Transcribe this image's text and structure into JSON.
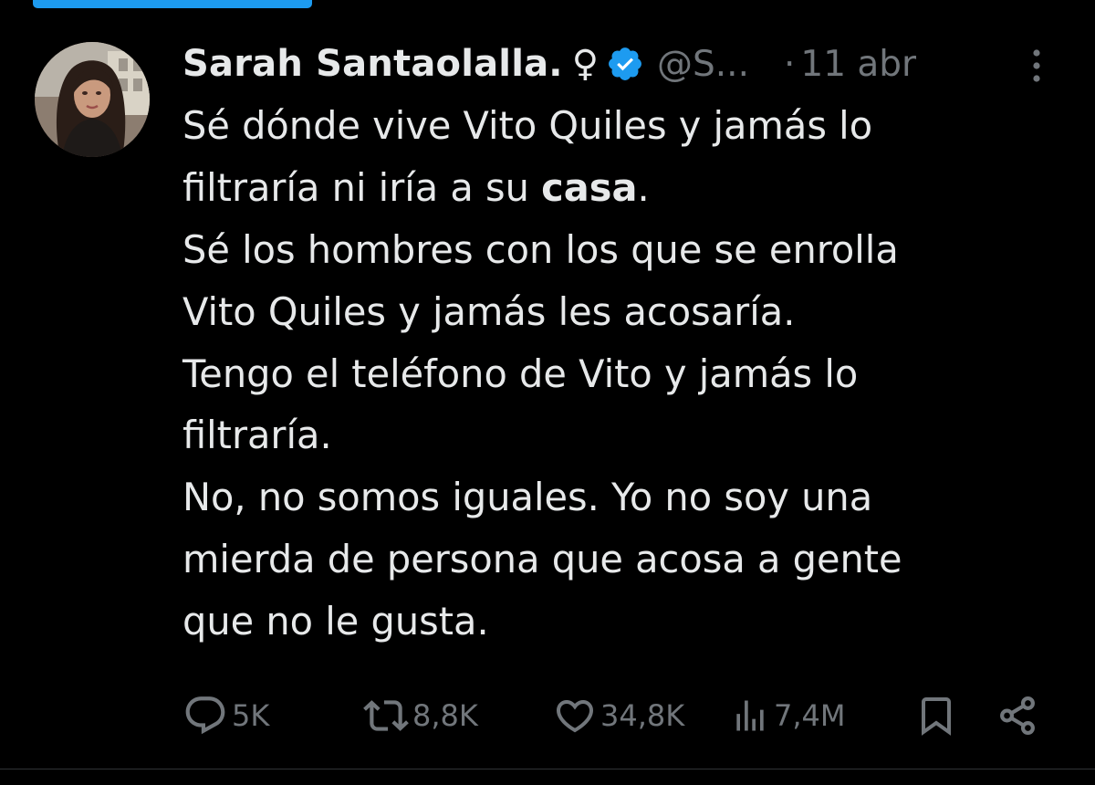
{
  "colors": {
    "background": "#000000",
    "text_primary": "#e7e9ea",
    "text_secondary": "#71767b",
    "accent": "#1d9bf0"
  },
  "author": {
    "avatar_icon": "profile-photo",
    "display_name": "Sarah Santaolalla.",
    "name_symbol": "♀",
    "verified_icon": "verified-badge-icon",
    "handle": "@S...",
    "separator": "·",
    "date": "11 abr",
    "more_icon": "more-vertical-icon"
  },
  "tweet": {
    "lines": [
      "Sé dónde vive Vito Quiles y jamás lo",
      "filtraría ni iría a su ",
      "Sé los hombres con los que se enrolla",
      "Vito Quiles y jamás les acosaría.",
      "Tengo el teléfono de Vito y jamás lo",
      "filtraría.",
      "No, no somos iguales. Yo no soy una",
      "mierda de persona que acosa a gente",
      "que no le gusta."
    ],
    "bold_word": "casa",
    "line2_end": "."
  },
  "actions": {
    "reply": {
      "icon": "reply-icon",
      "count": "5K"
    },
    "repost": {
      "icon": "repost-icon",
      "count": "8,8K"
    },
    "like": {
      "icon": "heart-icon",
      "count": "34,8K"
    },
    "views": {
      "icon": "views-icon",
      "count": "7,4M"
    },
    "bookmark": {
      "icon": "bookmark-icon"
    },
    "share": {
      "icon": "share-icon"
    }
  }
}
